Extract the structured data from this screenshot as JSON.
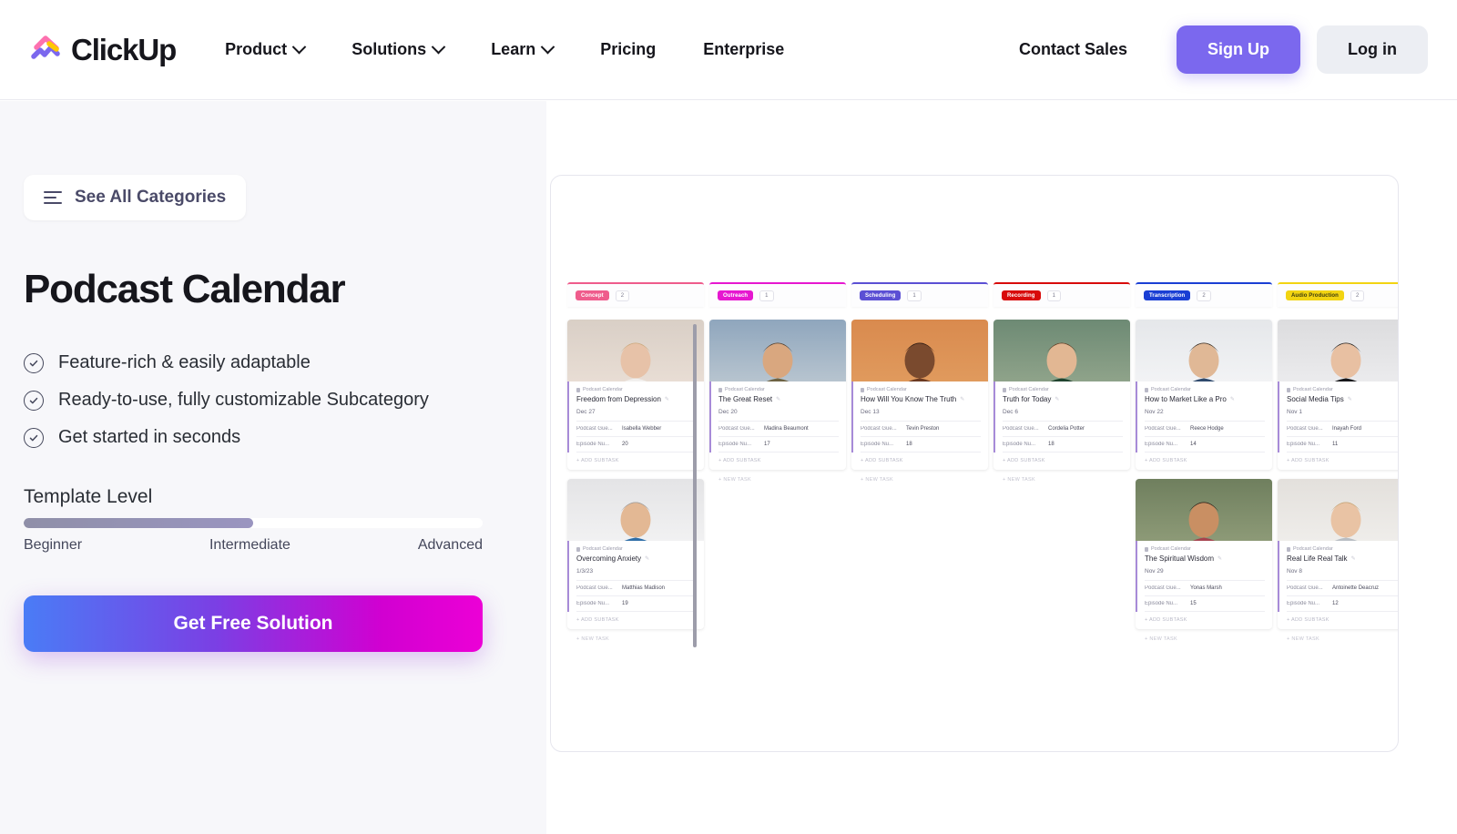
{
  "header": {
    "logo_text": "ClickUp",
    "nav": [
      {
        "label": "Product",
        "has_dropdown": true
      },
      {
        "label": "Solutions",
        "has_dropdown": true
      },
      {
        "label": "Learn",
        "has_dropdown": true
      },
      {
        "label": "Pricing",
        "has_dropdown": false
      },
      {
        "label": "Enterprise",
        "has_dropdown": false
      }
    ],
    "contact_sales": "Contact Sales",
    "sign_up": "Sign Up",
    "log_in": "Log in",
    "accent_color": "#7b68ee"
  },
  "left": {
    "see_all_categories": "See All Categories",
    "title": "Podcast Calendar",
    "features": [
      "Feature-rich & easily adaptable",
      "Ready-to-use, fully customizable Subcategory",
      "Get started in seconds"
    ],
    "template_level_label": "Template Level",
    "level_percent": 50,
    "level_marks": [
      "Beginner",
      "Intermediate",
      "Advanced"
    ],
    "cta_label": "Get Free Solution"
  },
  "board": {
    "add_subtask_label": "+ ADD SUBTASK",
    "new_task_label": "+ NEW TASK",
    "field_labels": {
      "guest": "Podcast Gue...",
      "episode": "Episode Nu..."
    },
    "breadcrumb": "Podcast Calendar",
    "columns": [
      {
        "name": "Concept",
        "count": "2",
        "color": "#ef5c8c",
        "cards": [
          {
            "title": "Freedom from Depression",
            "date": "Dec 27",
            "guest": "Isabella Webber",
            "episode": "20",
            "img_top": "#d9cfc6",
            "img_mid": "#e8ddd4",
            "skin": "#e7c2a8",
            "hair": "#c9a87c",
            "shirt": "#f2f0ee"
          },
          {
            "title": "Overcoming Anxiety",
            "date": "1/3/23",
            "guest": "Matthias Madison",
            "episode": "19",
            "img_top": "#e4e4e6",
            "img_mid": "#f1f1f2",
            "skin": "#e3b894",
            "hair": "#9a9a9a",
            "shirt": "#2f6ea8"
          }
        ]
      },
      {
        "name": "Outreach",
        "count": "1",
        "color": "#e617d0",
        "cards": [
          {
            "title": "The Great Reset",
            "date": "Dec 20",
            "guest": "Madina Beaumont",
            "episode": "17",
            "img_top": "#8fa6bd",
            "img_mid": "#b7c4cf",
            "skin": "#d9a77f",
            "hair": "#4a3a2c",
            "shirt": "#6e6343"
          }
        ]
      },
      {
        "name": "Scheduling",
        "count": "1",
        "color": "#5b4fd4",
        "cards": [
          {
            "title": "How Will You Know The Truth",
            "date": "Dec 13",
            "guest": "Tevin Preston",
            "episode": "18",
            "img_top": "#d98a4e",
            "img_mid": "#e09a5d",
            "skin": "#7a4a2e",
            "hair": "#2b1a12",
            "shirt": "#6b3a22"
          }
        ]
      },
      {
        "name": "Recording",
        "count": "1",
        "color": "#d80b0b",
        "cards": [
          {
            "title": "Truth for Today",
            "date": "Dec 6",
            "guest": "Cordelia Potter",
            "episode": "18",
            "img_top": "#6d8a74",
            "img_mid": "#8fa38a",
            "skin": "#e2b793",
            "hair": "#5c3a22",
            "shirt": "#20442f"
          }
        ]
      },
      {
        "name": "Transcription",
        "count": "2",
        "color": "#1a3fd4",
        "cards": [
          {
            "title": "How to Market Like a Pro",
            "date": "Nov 22",
            "guest": "Reece Hodge",
            "episode": "14",
            "img_top": "#e5e7ea",
            "img_mid": "#f2f3f5",
            "skin": "#e0b896",
            "hair": "#2e2720",
            "shirt": "#2f4a6d"
          },
          {
            "title": "The Spiritual Wisdom",
            "date": "Nov 29",
            "guest": "Yonas Marsh",
            "episode": "15",
            "img_top": "#6f7f5e",
            "img_mid": "#8d9a77",
            "skin": "#c98f63",
            "hair": "#241a14",
            "shirt": "#a6444f"
          }
        ]
      },
      {
        "name": "Audio Production",
        "count": "2",
        "color": "#f2d412",
        "text_dark": true,
        "cards": [
          {
            "title": "Social Media Tips",
            "date": "Nov 1",
            "guest": "Inayah Ford",
            "episode": "11",
            "img_top": "#dcdcde",
            "img_mid": "#ebebed",
            "skin": "#e8c0a2",
            "hair": "#1c1c1c",
            "shirt": "#17171a"
          },
          {
            "title": "Real Life Real Talk",
            "date": "Nov 8",
            "guest": "Antoinette Deacruz",
            "episode": "12",
            "img_top": "#e3e0dc",
            "img_mid": "#efedea",
            "skin": "#e9c3a4",
            "hair": "#c3a374",
            "shirt": "#b9bec4"
          }
        ]
      }
    ]
  }
}
